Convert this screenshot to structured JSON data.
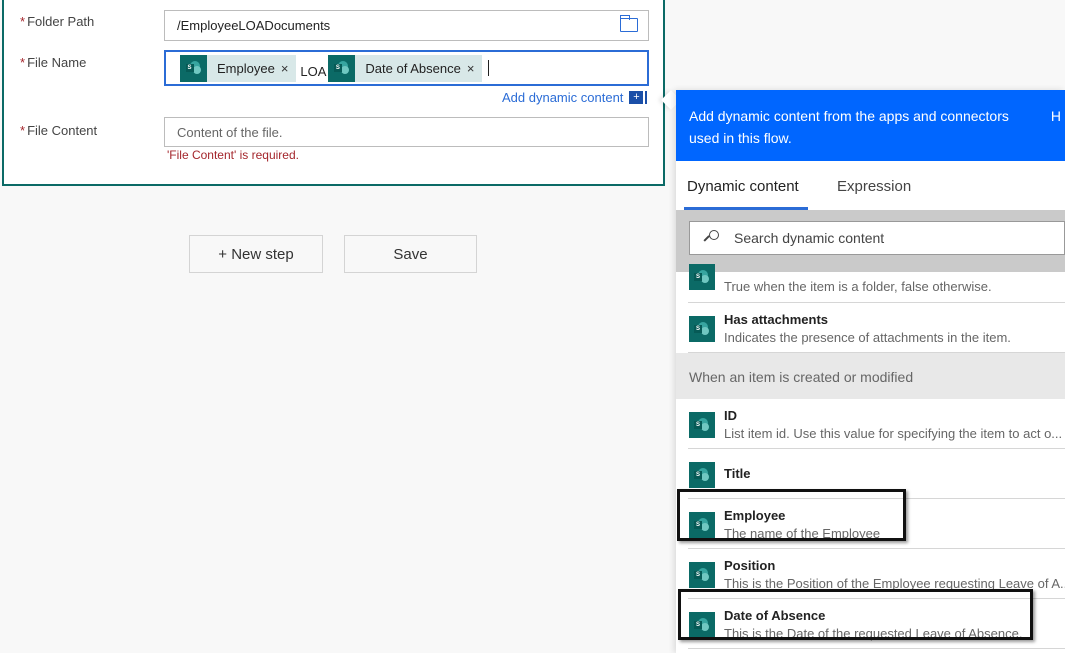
{
  "form": {
    "folder_path": {
      "label": "Folder Path",
      "value": "/EmployeeLOADocuments",
      "required_mark": "*"
    },
    "file_name": {
      "label": "File Name",
      "required_mark": "*",
      "tokens": [
        {
          "type": "chip",
          "label": "Employee",
          "remove": "×"
        },
        {
          "type": "text",
          "label": "LOA"
        },
        {
          "type": "chip",
          "label": "Date of Absence",
          "remove": "×"
        }
      ]
    },
    "add_dynamic_content": "Add dynamic content",
    "add_dynamic_plus": "+",
    "file_content": {
      "label": "File Content",
      "placeholder": "Content of the file.",
      "required_mark": "*",
      "error": "'File Content' is required."
    }
  },
  "actions": {
    "new_step": "+ New step",
    "save": "Save"
  },
  "panel": {
    "header_text": "Add dynamic content from the apps and connectors used in this flow.",
    "header_cut": "H",
    "tabs": [
      {
        "label": "Dynamic content",
        "active": true
      },
      {
        "label": "Expression",
        "active": false
      }
    ],
    "search_placeholder": "Search dynamic content",
    "items_before": [
      {
        "title": "",
        "desc": "True when the item is a folder, false otherwise."
      },
      {
        "title": "Has attachments",
        "desc": "Indicates the presence of attachments in the item."
      }
    ],
    "group_header": "When an item is created or modified",
    "items": [
      {
        "title": "ID",
        "desc": "List item id. Use this value for specifying the item to act o..."
      },
      {
        "title": "Title",
        "desc": ""
      },
      {
        "title": "Employee",
        "desc": "The name of the Employee",
        "highlighted": true
      },
      {
        "title": "Position",
        "desc": "This is the Position of the Employee requesting Leave of A..."
      },
      {
        "title": "Date of Absence",
        "desc": "This is the Date of the requested Leave of Absence.",
        "highlighted": true
      }
    ]
  },
  "colors": {
    "accent": "#0066ff",
    "sharepoint_teal": "#0b6a66",
    "error": "#a4262c",
    "link": "#2b6cd6"
  }
}
